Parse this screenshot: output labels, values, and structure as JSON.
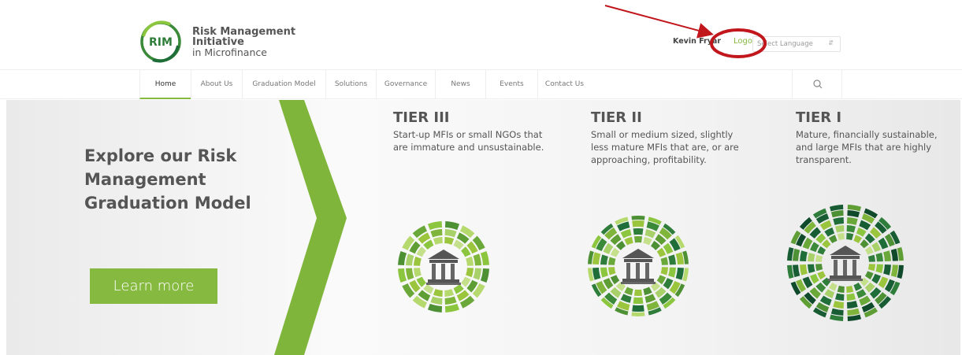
{
  "header": {
    "logo_abbrev": "RIM",
    "logo_line1": "Risk Management",
    "logo_line2": "Initiative",
    "logo_line3": "in Microfinance",
    "user_name": "Kevin Fryar",
    "logout_label": "Logout",
    "language_placeholder": "Select Language"
  },
  "nav": {
    "items": [
      {
        "label": "Home"
      },
      {
        "label": "About Us"
      },
      {
        "label": "Graduation Model"
      },
      {
        "label": "Solutions"
      },
      {
        "label": "Governance"
      },
      {
        "label": "News"
      },
      {
        "label": "Events"
      },
      {
        "label": "Contact Us"
      }
    ],
    "search_icon": "search-icon"
  },
  "hero": {
    "title": "Explore our Risk Management Graduation Model",
    "button_label": "Learn more",
    "tiers": [
      {
        "title": "TIER III",
        "desc": "Start-up MFIs or small NGOs that are immature and unsustainable."
      },
      {
        "title": "TIER II",
        "desc": "Small or medium sized, slightly less mature MFIs that are, or are approaching, profitability."
      },
      {
        "title": "TIER I",
        "desc": "Mature, financially sustainable, and large MFIs that are highly transparent."
      }
    ]
  },
  "colors": {
    "accent": "#86b940",
    "annotation": "#c0161c"
  }
}
